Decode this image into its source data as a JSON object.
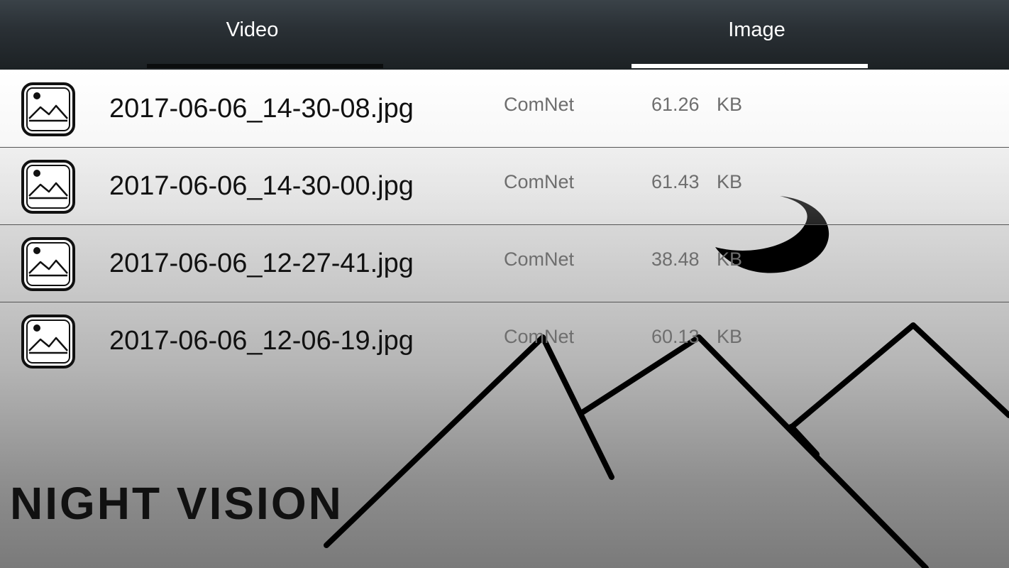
{
  "tabs": [
    {
      "label": "Video",
      "selected": false
    },
    {
      "label": "Image",
      "selected": true
    }
  ],
  "files": [
    {
      "name": "2017-06-06_14-30-08.jpg",
      "source": "ComNet",
      "size": "61.26",
      "unit": "KB",
      "icon": "image-file-icon"
    },
    {
      "name": "2017-06-06_14-30-00.jpg",
      "source": "ComNet",
      "size": "61.43",
      "unit": "KB",
      "icon": "image-file-icon"
    },
    {
      "name": "2017-06-06_12-27-41.jpg",
      "source": "ComNet",
      "size": "38.48",
      "unit": "KB",
      "icon": "image-file-icon"
    },
    {
      "name": "2017-06-06_12-06-19.jpg",
      "source": "ComNet",
      "size": "60.13",
      "unit": "KB",
      "icon": "image-file-icon"
    }
  ],
  "background": {
    "brand_text": "NIGHT VISION",
    "art": [
      "moon-icon",
      "mountains-art"
    ]
  },
  "colors": {
    "tab_bar": "#1c2124",
    "active_indicator": "#ffffff",
    "filename_text": "#111111",
    "meta_text": "#6e6e6e"
  }
}
